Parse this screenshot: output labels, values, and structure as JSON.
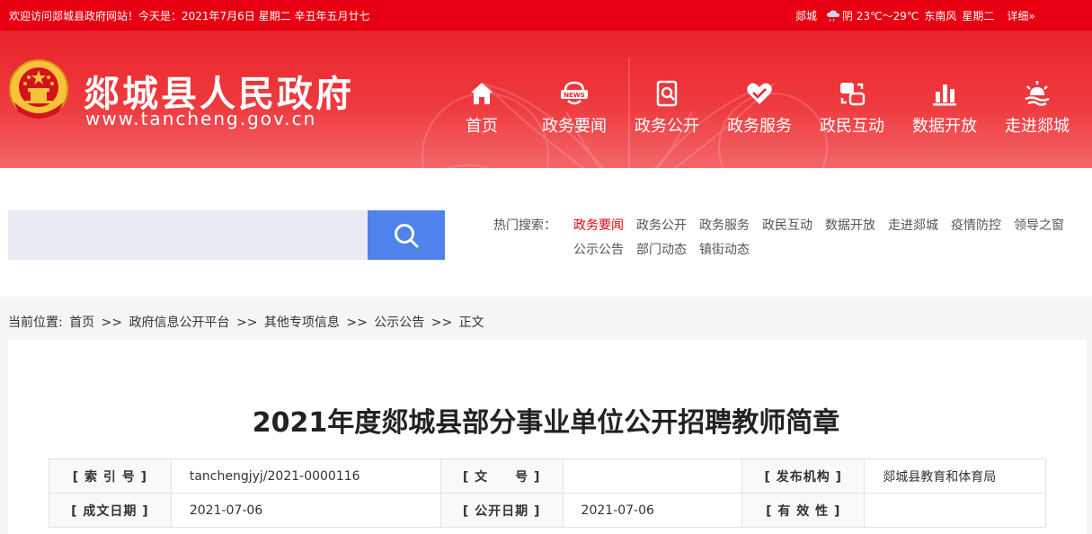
{
  "topbar": {
    "welcome": "欢迎访问郯城县政府网站！今天是：2021年7月6日  星期二  辛丑年五月廿七",
    "city": "郯城",
    "weather_icon": "rain-cloud-icon",
    "weather": "阴 23℃～29℃",
    "wind": "东南风",
    "weekday": "星期二",
    "detail": "详细»"
  },
  "header": {
    "title": "郯城县人民政府",
    "url": "www.tancheng.gov.cn",
    "nav": [
      {
        "label": "首页",
        "icon": "home-icon"
      },
      {
        "label": "政务要闻",
        "icon": "news-icon"
      },
      {
        "label": "政务公开",
        "icon": "document-search-icon"
      },
      {
        "label": "政务服务",
        "icon": "heart-hands-icon"
      },
      {
        "label": "政民互动",
        "icon": "exchange-icon"
      },
      {
        "label": "数据开放",
        "icon": "bar-chart-icon"
      },
      {
        "label": "走进郯城",
        "icon": "sunrise-icon"
      }
    ]
  },
  "search": {
    "placeholder": "",
    "button_icon": "search-icon",
    "hot_label": "热门搜索：",
    "hot_links": [
      "政务要闻",
      "政务公开",
      "政务服务",
      "政民互动",
      "数据开放",
      "走进郯城",
      "疫情防控",
      "领导之窗",
      "公示公告",
      "部门动态",
      "镇街动态"
    ]
  },
  "breadcrumb": {
    "label": "当前位置:",
    "items": [
      "首页",
      "政府信息公开平台",
      "其他专项信息",
      "公示公告",
      "正文"
    ],
    "sep": ">>"
  },
  "article": {
    "title": "2021年度郯城县部分事业单位公开招聘教师简章",
    "meta": {
      "index_label": "[ 索 引 号 ]",
      "index_value": "tanchengjyj/2021-0000116",
      "doc_label": "[ 文　　号 ]",
      "doc_value": "",
      "org_label": "[ 发布机构 ]",
      "org_value": "郯城县教育和体育局",
      "created_label": "[ 成文日期 ]",
      "created_value": "2021-07-06",
      "published_label": "[ 公开日期 ]",
      "published_value": "2021-07-06",
      "valid_label": "[ 有 效 性 ]",
      "valid_value": ""
    }
  },
  "colors": {
    "brand_red": "#e60012",
    "search_blue": "#4f82ea",
    "search_bg": "#e8ebf4"
  }
}
